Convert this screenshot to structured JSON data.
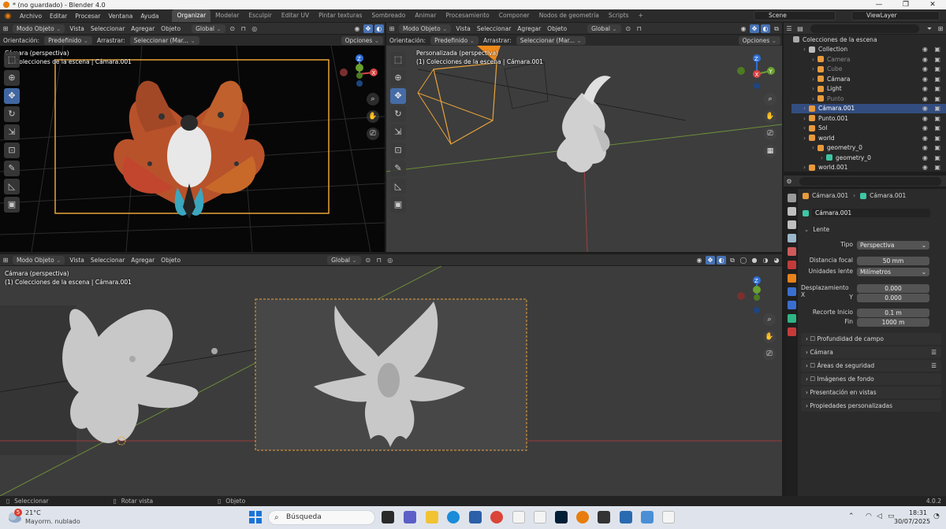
{
  "window": {
    "title": "* (no guardado) - Blender 4.0",
    "controls": [
      "—",
      "❐",
      "✕"
    ]
  },
  "menu": [
    "Archivo",
    "Editar",
    "Procesar",
    "Ventana",
    "Ayuda"
  ],
  "workspaces": [
    "Organizar",
    "Modelar",
    "Esculpir",
    "Editar UV",
    "Pintar texturas",
    "Sombreado",
    "Animar",
    "Procesamiento",
    "Componer",
    "Nodos de geometría",
    "Scripts"
  ],
  "active_workspace": "Organizar",
  "add_workspace": "+",
  "scene": "Scene",
  "view_layer": "ViewLayer",
  "viewport_header": {
    "mode": "Modo Objeto",
    "vista": "Vista",
    "seleccionar": "Seleccionar",
    "agregar": "Agregar",
    "objeto": "Objeto",
    "global": "Global"
  },
  "tool_header": {
    "orientacion": "Orientación:",
    "predefinido": "Predefinido",
    "arrastrar": "Arrastrar:",
    "seleccionar_mar": "Seleccionar (Mar...",
    "opciones": "Opciones"
  },
  "viewport1": {
    "line1": "Cámara (perspectiva)",
    "line2": "(1) Colecciones de la escena | Cámara.001"
  },
  "viewport2": {
    "line1": "Personalizada (perspectiva)",
    "line2": "(1) Colecciones de la escena | Cámara.001"
  },
  "viewport3": {
    "line1": "Cámara (perspectiva)",
    "line2": "(1) Colecciones de la escena | Cámara.001"
  },
  "gizmo": {
    "x": "X",
    "y": "Y",
    "z": "Z"
  },
  "outliner": {
    "header": "Colecciones de la escena",
    "rows": [
      {
        "label": "Collection",
        "indent": 1,
        "color": "#d9d9d9",
        "icon_color": "#bbbbbb",
        "dim": false,
        "selected": false
      },
      {
        "label": "Camera",
        "indent": 2,
        "color": "#8a8a8a",
        "icon_color": "#e89a3c",
        "dim": true,
        "selected": false
      },
      {
        "label": "Cube",
        "indent": 2,
        "color": "#8a8a8a",
        "icon_color": "#e89a3c",
        "dim": true,
        "selected": false
      },
      {
        "label": "Cámara",
        "indent": 2,
        "color": "#e0e0e0",
        "icon_color": "#e89a3c",
        "dim": false,
        "selected": false
      },
      {
        "label": "Light",
        "indent": 2,
        "color": "#e0e0e0",
        "icon_color": "#e89a3c",
        "dim": false,
        "selected": false
      },
      {
        "label": "Punto",
        "indent": 2,
        "color": "#8a8a8a",
        "icon_color": "#e89a3c",
        "dim": true,
        "selected": false
      },
      {
        "label": "Cámara.001",
        "indent": 1,
        "color": "#ffffff",
        "icon_color": "#e89a3c",
        "dim": false,
        "selected": true
      },
      {
        "label": "Punto.001",
        "indent": 1,
        "color": "#e0e0e0",
        "icon_color": "#e89a3c",
        "dim": false,
        "selected": false
      },
      {
        "label": "Sol",
        "indent": 1,
        "color": "#e0e0e0",
        "icon_color": "#e89a3c",
        "dim": false,
        "selected": false
      },
      {
        "label": "world",
        "indent": 1,
        "color": "#e0e0e0",
        "icon_color": "#e89a3c",
        "dim": false,
        "selected": false
      },
      {
        "label": "geometry_0",
        "indent": 2,
        "color": "#e0e0e0",
        "icon_color": "#e89a3c",
        "dim": false,
        "selected": false
      },
      {
        "label": "geometry_0",
        "indent": 3,
        "color": "#e0e0e0",
        "icon_color": "#3ec6a4",
        "dim": false,
        "selected": false
      },
      {
        "label": "world.001",
        "indent": 1,
        "color": "#e0e0e0",
        "icon_color": "#e89a3c",
        "dim": false,
        "selected": false
      }
    ]
  },
  "properties": {
    "breadcrumb_object": "Cámara.001",
    "breadcrumb_data": "Cámara.001",
    "datablock": "Cámara.001",
    "panel_lente": "Lente",
    "tipo_label": "Tipo",
    "tipo_value": "Perspectiva",
    "focal_label": "Distancia focal",
    "focal_value": "50 mm",
    "unidades_label": "Unidades lente",
    "unidades_value": "Milímetros",
    "despx_label": "Desplazamiento X",
    "despx_value": "0.000",
    "despy_label": "Y",
    "despy_value": "0.000",
    "recorte_label": "Recorte  Inicio",
    "recorte_value": "0.1 m",
    "fin_label": "Fin",
    "fin_value": "1000 m",
    "sections": [
      "Profundidad de campo",
      "Cámara",
      "Áreas de seguridad",
      "Imágenes de fondo",
      "Presentación en vistas",
      "Propiedades personalizadas"
    ]
  },
  "status": {
    "seleccionar": "Seleccionar",
    "rotar": "Rotar vista",
    "objeto": "Objeto",
    "version": "4.0.2"
  },
  "taskbar": {
    "temp": "21°C",
    "weather": "Mayorm. nublado",
    "badge": "5",
    "search": "Búsqueda",
    "time": "18:31",
    "date": "30/07/2025"
  },
  "colors": {
    "accent": "#4772b3",
    "camera_frame": "#e8a33a",
    "selection": "#334d80",
    "blender_orange": "#e87d0d"
  }
}
